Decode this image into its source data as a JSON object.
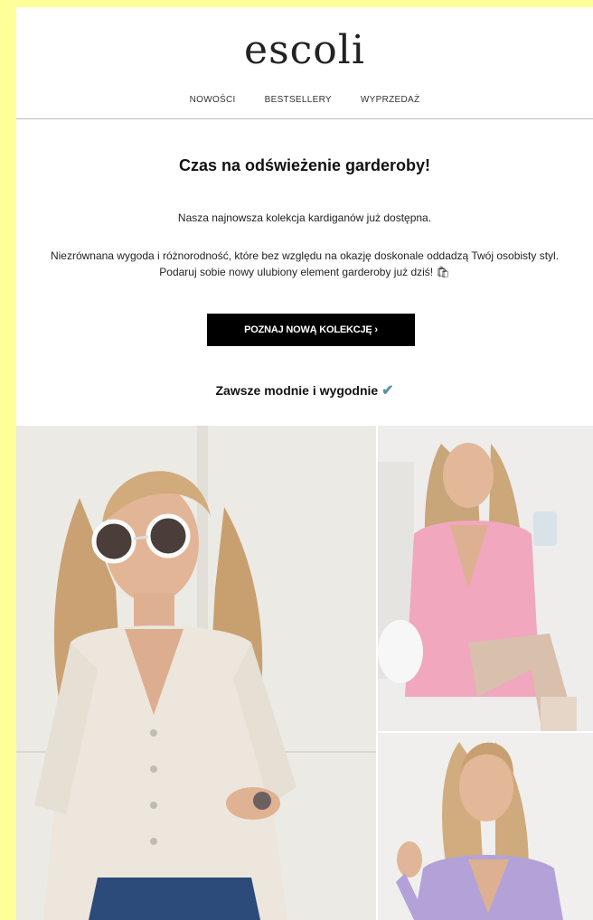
{
  "brand": {
    "logo_text": "escoli"
  },
  "nav": [
    {
      "label": "NOWOŚCI"
    },
    {
      "label": "BESTSELLERY"
    },
    {
      "label": "WYPRZEDAŻ"
    }
  ],
  "hero": {
    "headline": "Czas na odświeżenie garderoby!",
    "lead": "Nasza najnowsza kolekcja kardiganów już dostępna.",
    "body": "Niezrównana wygoda i różnorodność, które bez względu na okazję doskonale oddadzą Twój osobisty styl. Podaruj sobie nowy ulubiony element garderoby już dziś! 🛍",
    "cta_label": "POZNAJ NOWĄ KOLEKCJĘ ›",
    "tagline": "Zawsze modnie i wygodnie",
    "tagline_icon": "✔"
  },
  "colors": {
    "page_background": "#ffff99",
    "cta_background": "#000000",
    "cta_text": "#ffffff",
    "divider": "#bdbdbd"
  },
  "photos": [
    {
      "icon": "photo-cream-cardigan"
    },
    {
      "icon": "photo-pink-cardigan"
    },
    {
      "icon": "photo-lilac-cardigan"
    }
  ]
}
